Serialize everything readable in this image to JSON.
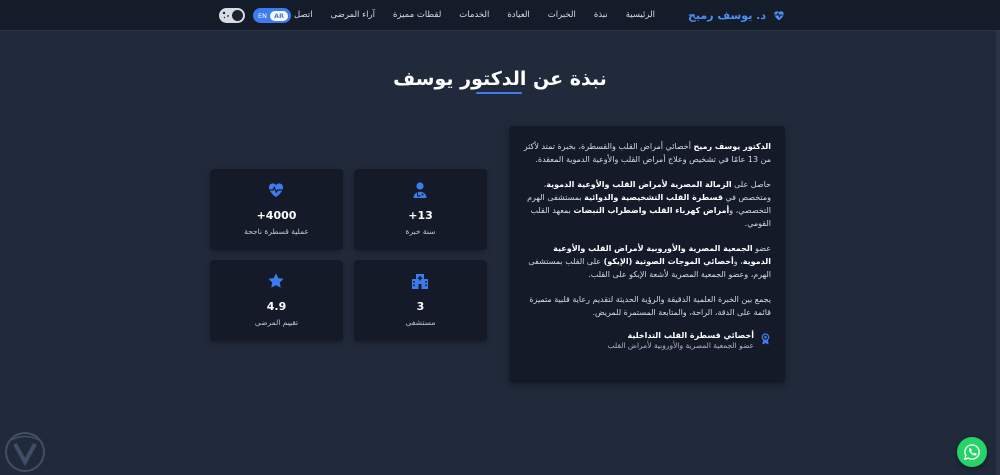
{
  "brand": {
    "name": "د. يوسف رميح"
  },
  "nav": {
    "items": [
      "الرئيسية",
      "نبذة",
      "الخبرات",
      "العيادة",
      "الخدمات",
      "لقطات مميزة",
      "آراء المرضى",
      "اتصل بنا"
    ]
  },
  "lang": {
    "en": "EN",
    "ar": "AR"
  },
  "about": {
    "title": "نبذة عن الدكتور يوسف",
    "p1_bold": "الدكتور يوسف رميح",
    "p1_rest": " أخصائي أمراض القلب والقسطرة، بخبرة تمتد لأكثر من 13 عامًا في تشخيص وعلاج أمراض القلب والأوعية الدموية المعقدة.",
    "p2_a": "حاصل على ",
    "p2_b": "الزمالة المصرية لأمراض القلب والأوعية الدموية",
    "p2_c": "، ومتخصص في ",
    "p2_d": "قسطرة القلب التشخيصية والدوائية",
    "p2_e": " بمستشفى الهرم التخصصي، و",
    "p2_f": "أمراض كهرباء القلب واضطراب النبضات",
    "p2_g": " بمعهد القلب القومي.",
    "p3_a": "عضو ",
    "p3_b": "الجمعية المصرية والأوروبية لأمراض القلب والأوعية الدموية",
    "p3_c": "، و",
    "p3_d": "أخصائي الموجات الصوتية (الإيكو)",
    "p3_e": " على القلب بمستشفى الهرم، وعضو الجمعية المصرية لأشعة الإيكو على القلب.",
    "p4": "يجمع بين الخبرة العلمية الدقيقة والرؤية الحديثة لتقديم رعاية قلبية متميزة قائمة على الدقة، الراحة، والمتابعة المستمرة للمريض.",
    "role_title": "أخصائي قسطرة القلب التداخلية",
    "role_sub": "عضو الجمعية المصرية والأوروبية لأمراض القلب"
  },
  "stats": [
    {
      "icon": "doctor-icon",
      "value": "+13",
      "label": "سنة خبرة"
    },
    {
      "icon": "heartbeat-icon",
      "value": "+4000",
      "label": "عملية قسطرة ناجحة"
    },
    {
      "icon": "hospital-icon",
      "value": "3",
      "label": "مستشفى"
    },
    {
      "icon": "star-icon",
      "value": "4.9",
      "label": "تقييم المرضى"
    }
  ],
  "colors": {
    "accent": "#3d7cf0",
    "background": "#212a3b",
    "card": "#141a28",
    "whatsapp": "#25d366"
  }
}
